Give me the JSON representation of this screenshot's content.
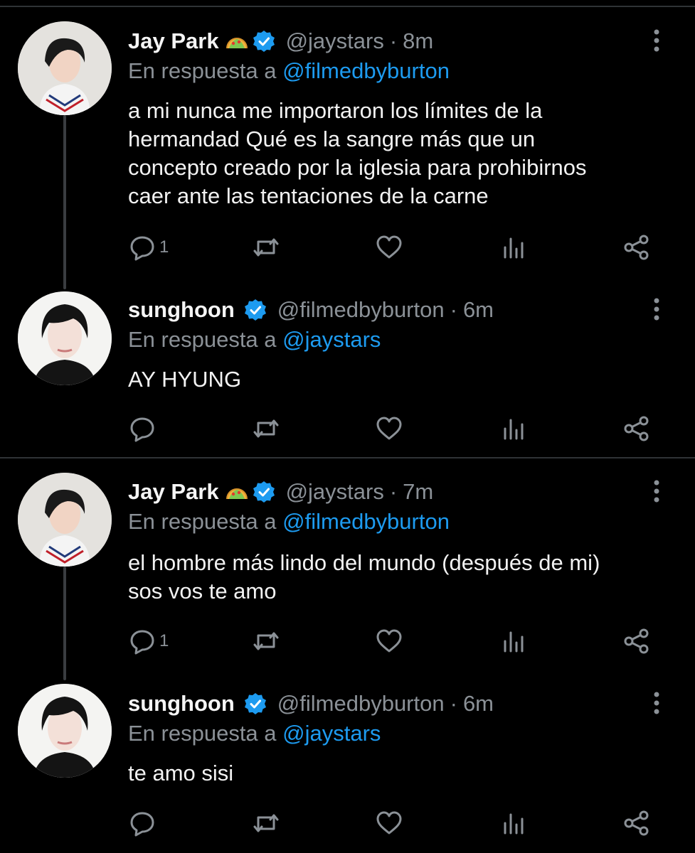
{
  "tweets": [
    {
      "name": "Jay Park",
      "name_emoji": "taco-emoji",
      "handle": "@jaystars",
      "time": "8m",
      "reply_prefix": "En respuesta a",
      "reply_to": "@filmedbyburton",
      "lines": [
        "a mi nunca me importaron los límites de la",
        "hermandad Qué es la sangre más que un",
        "concepto creado por la iglesia para prohibirnos",
        "caer ante las tentaciones de la carne"
      ],
      "reply_count": "1"
    },
    {
      "name": "sunghoon",
      "handle": "@filmedbyburton",
      "time": "6m",
      "reply_prefix": "En respuesta a",
      "reply_to": "@jaystars",
      "lines": [
        "AY HYUNG"
      ],
      "reply_count": ""
    },
    {
      "name": "Jay Park",
      "name_emoji": "taco-emoji",
      "handle": "@jaystars",
      "time": "7m",
      "reply_prefix": "En respuesta a",
      "reply_to": "@filmedbyburton",
      "lines": [
        "el hombre más lindo del mundo (después de mi)",
        "sos vos te amo"
      ],
      "reply_count": "1"
    },
    {
      "name": "sunghoon",
      "handle": "@filmedbyburton",
      "time": "6m",
      "reply_prefix": "En respuesta a",
      "reply_to": "@jaystars",
      "lines": [
        "te amo sisi"
      ],
      "reply_count": ""
    }
  ],
  "colors": {
    "background": "#000000",
    "text": "#e7e9ea",
    "secondary": "#8b9197",
    "accent": "#1d9bf0",
    "divider": "#2f3336"
  },
  "action_icons": [
    "reply-icon",
    "retweet-icon",
    "like-icon",
    "analytics-icon",
    "share-icon"
  ]
}
